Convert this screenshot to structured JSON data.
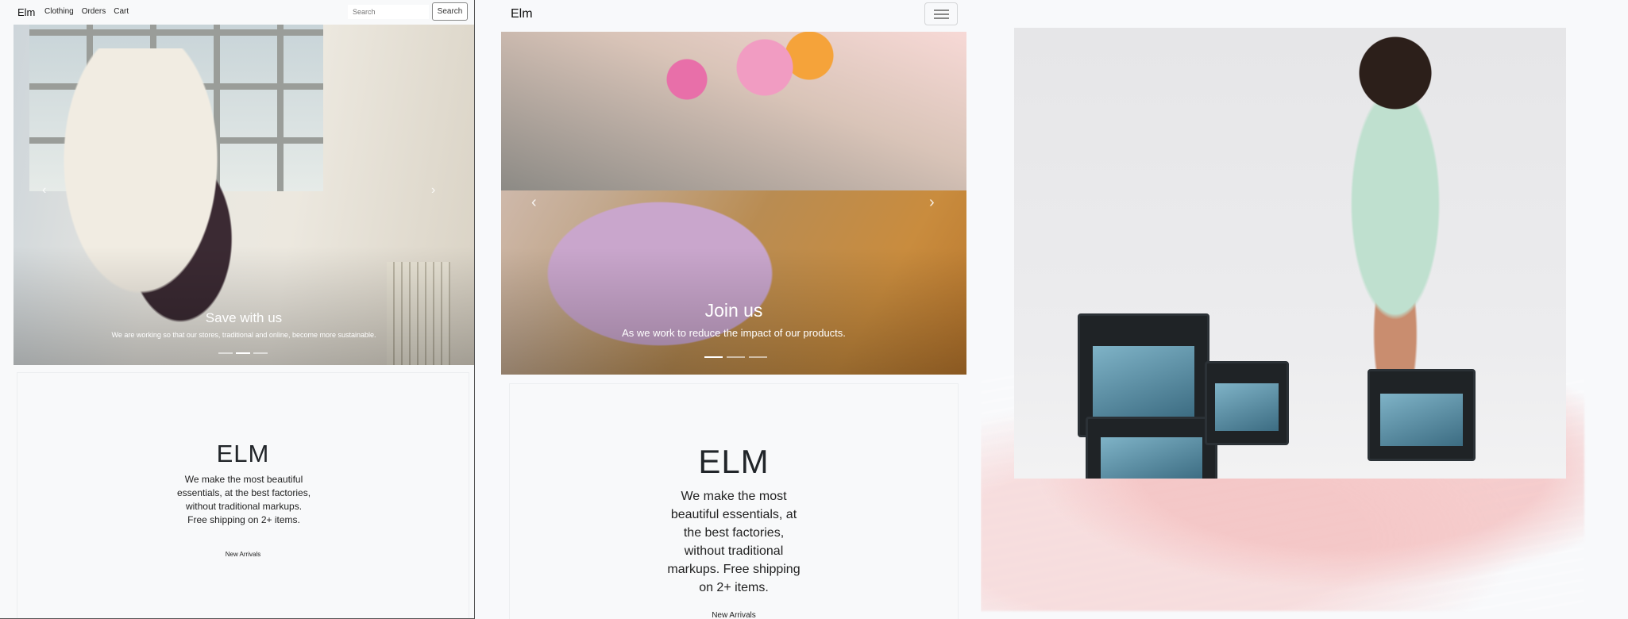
{
  "desktop": {
    "brand": "Elm",
    "nav_links": [
      "Clothing",
      "Orders",
      "Cart"
    ],
    "search": {
      "placeholder": "Search",
      "button_label": "Search"
    },
    "carousel": {
      "title": "Save with us",
      "text": "We are working so that our stores, traditional and online, become more sustainable.",
      "slide_count": 3,
      "active_slide": 2
    },
    "card": {
      "title": "ELM",
      "description": "We make the most beautiful essentials, at the best factories, without traditional markups. Free shipping on 2+ items.",
      "link": "New Arrivals"
    }
  },
  "mobile": {
    "brand": "Elm",
    "carousel": {
      "title": "Join us",
      "text": "As we work to reduce the impact of our products.",
      "slide_count": 3,
      "active_slide": 1
    },
    "card": {
      "title": "ELM",
      "description": "We make the most beautiful essentials, at the best factories, without traditional markups. Free shipping on 2+ items.",
      "link": "New Arrivals"
    }
  },
  "colors": {
    "background": "#f8f9fb",
    "text": "#212529",
    "accent_stroke": "#f4c4c4"
  },
  "icons": {
    "prev": "chevron-left-icon",
    "next": "chevron-right-icon",
    "menu": "hamburger-menu-icon"
  }
}
